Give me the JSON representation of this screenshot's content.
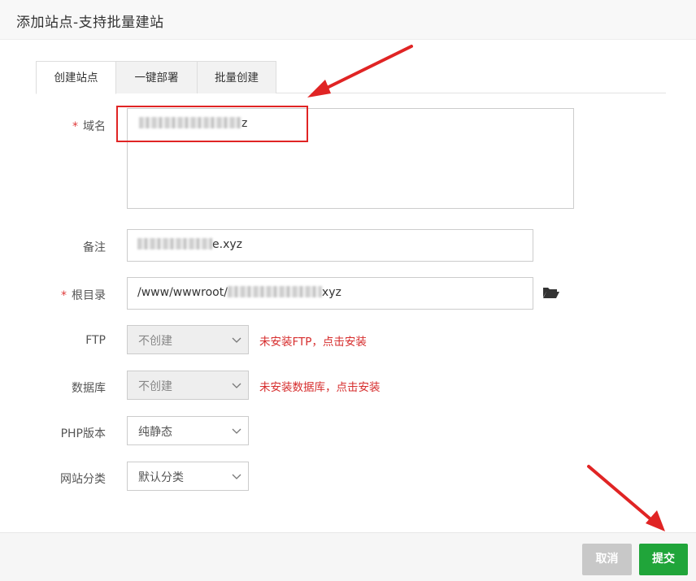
{
  "dialog": {
    "title": "添加站点-支持批量建站"
  },
  "tabs": [
    {
      "label": "创建站点",
      "active": true
    },
    {
      "label": "一键部署",
      "active": false
    },
    {
      "label": "批量创建",
      "active": false
    }
  ],
  "form": {
    "domain": {
      "label": "域名",
      "required_mark": "*",
      "value_suffix": "z"
    },
    "remark": {
      "label": "备注",
      "value_suffix": "e.xyz"
    },
    "root_dir": {
      "label": "根目录",
      "required_mark": "*",
      "value_prefix": "/www/wwwroot/",
      "value_suffix": "xyz",
      "browse_icon": "folder-open-icon"
    },
    "ftp": {
      "label": "FTP",
      "selected": "不创建",
      "disabled": true,
      "warning": "未安装FTP，点击安装"
    },
    "database": {
      "label": "数据库",
      "selected": "不创建",
      "disabled": true,
      "warning": "未安装数据库，点击安装"
    },
    "php_version": {
      "label": "PHP版本",
      "selected": "纯静态"
    },
    "site_category": {
      "label": "网站分类",
      "selected": "默认分类"
    }
  },
  "footer": {
    "cancel_label": "取消",
    "submit_label": "提交"
  },
  "colors": {
    "accent_green": "#20a53a",
    "warning_red": "#d62d2d",
    "annotation_red": "#e02424",
    "cancel_gray": "#c8c8c8"
  }
}
